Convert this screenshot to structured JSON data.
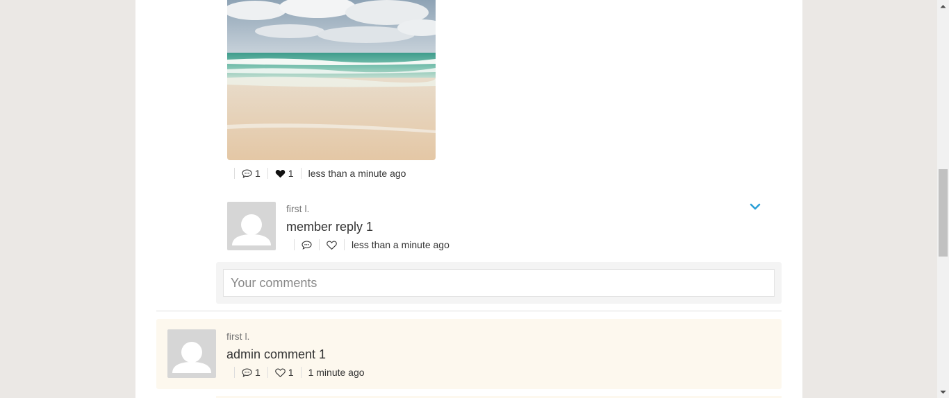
{
  "post": {
    "image": {
      "description_icon": "beach-photo"
    },
    "stats": {
      "comments_count": "1",
      "likes_count": "1",
      "time": "less than a minute ago"
    }
  },
  "reply": {
    "author": "first l.",
    "text": "member reply 1",
    "time": "less than a minute ago"
  },
  "comment_input": {
    "placeholder": "Your comments"
  },
  "admin_comment": {
    "author": "first l.",
    "text": "admin comment 1",
    "comments_count": "1",
    "likes_count": "1",
    "time": "1 minute ago"
  },
  "colors": {
    "accent": "#2a9fd6",
    "admin_bg": "#fdf8ee",
    "page_bg": "#ebe8e5"
  }
}
